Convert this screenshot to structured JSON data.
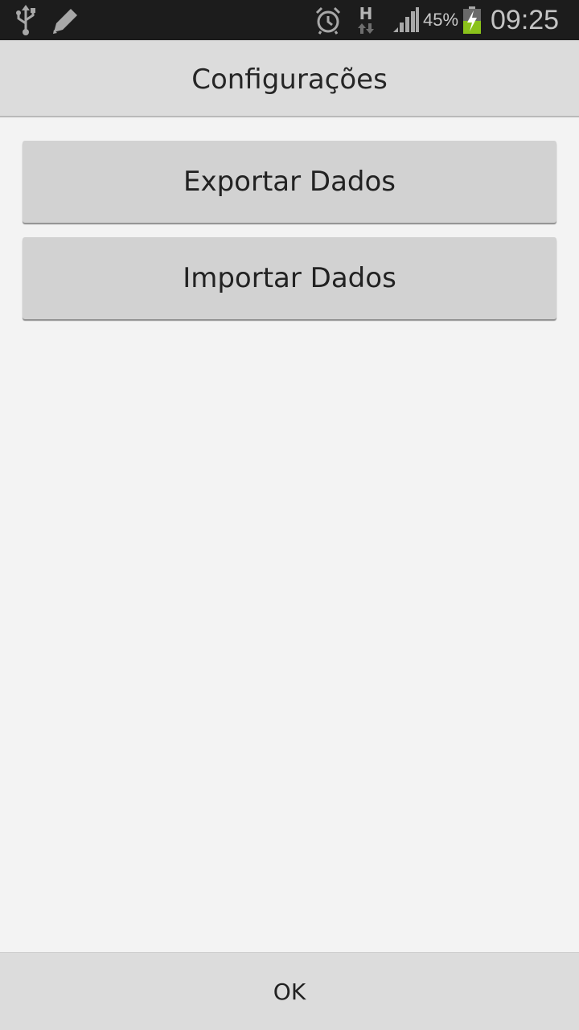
{
  "status_bar": {
    "network_type": "H",
    "battery_percent": "45%",
    "battery_level": 0.45,
    "time": "09:25",
    "icons": [
      "usb-icon",
      "edit-icon",
      "alarm-icon",
      "network-data-icon",
      "signal-icon",
      "battery-charging-icon"
    ]
  },
  "header": {
    "title": "Configurações"
  },
  "main": {
    "export_label": "Exportar Dados",
    "import_label": "Importar Dados"
  },
  "footer": {
    "ok_label": "OK"
  },
  "colors": {
    "status_bar_bg": "#1c1c1c",
    "title_bar_bg": "#dcdcdc",
    "content_bg": "#f3f3f3",
    "button_bg": "#d2d2d2",
    "battery_green": "#8bc21b"
  }
}
